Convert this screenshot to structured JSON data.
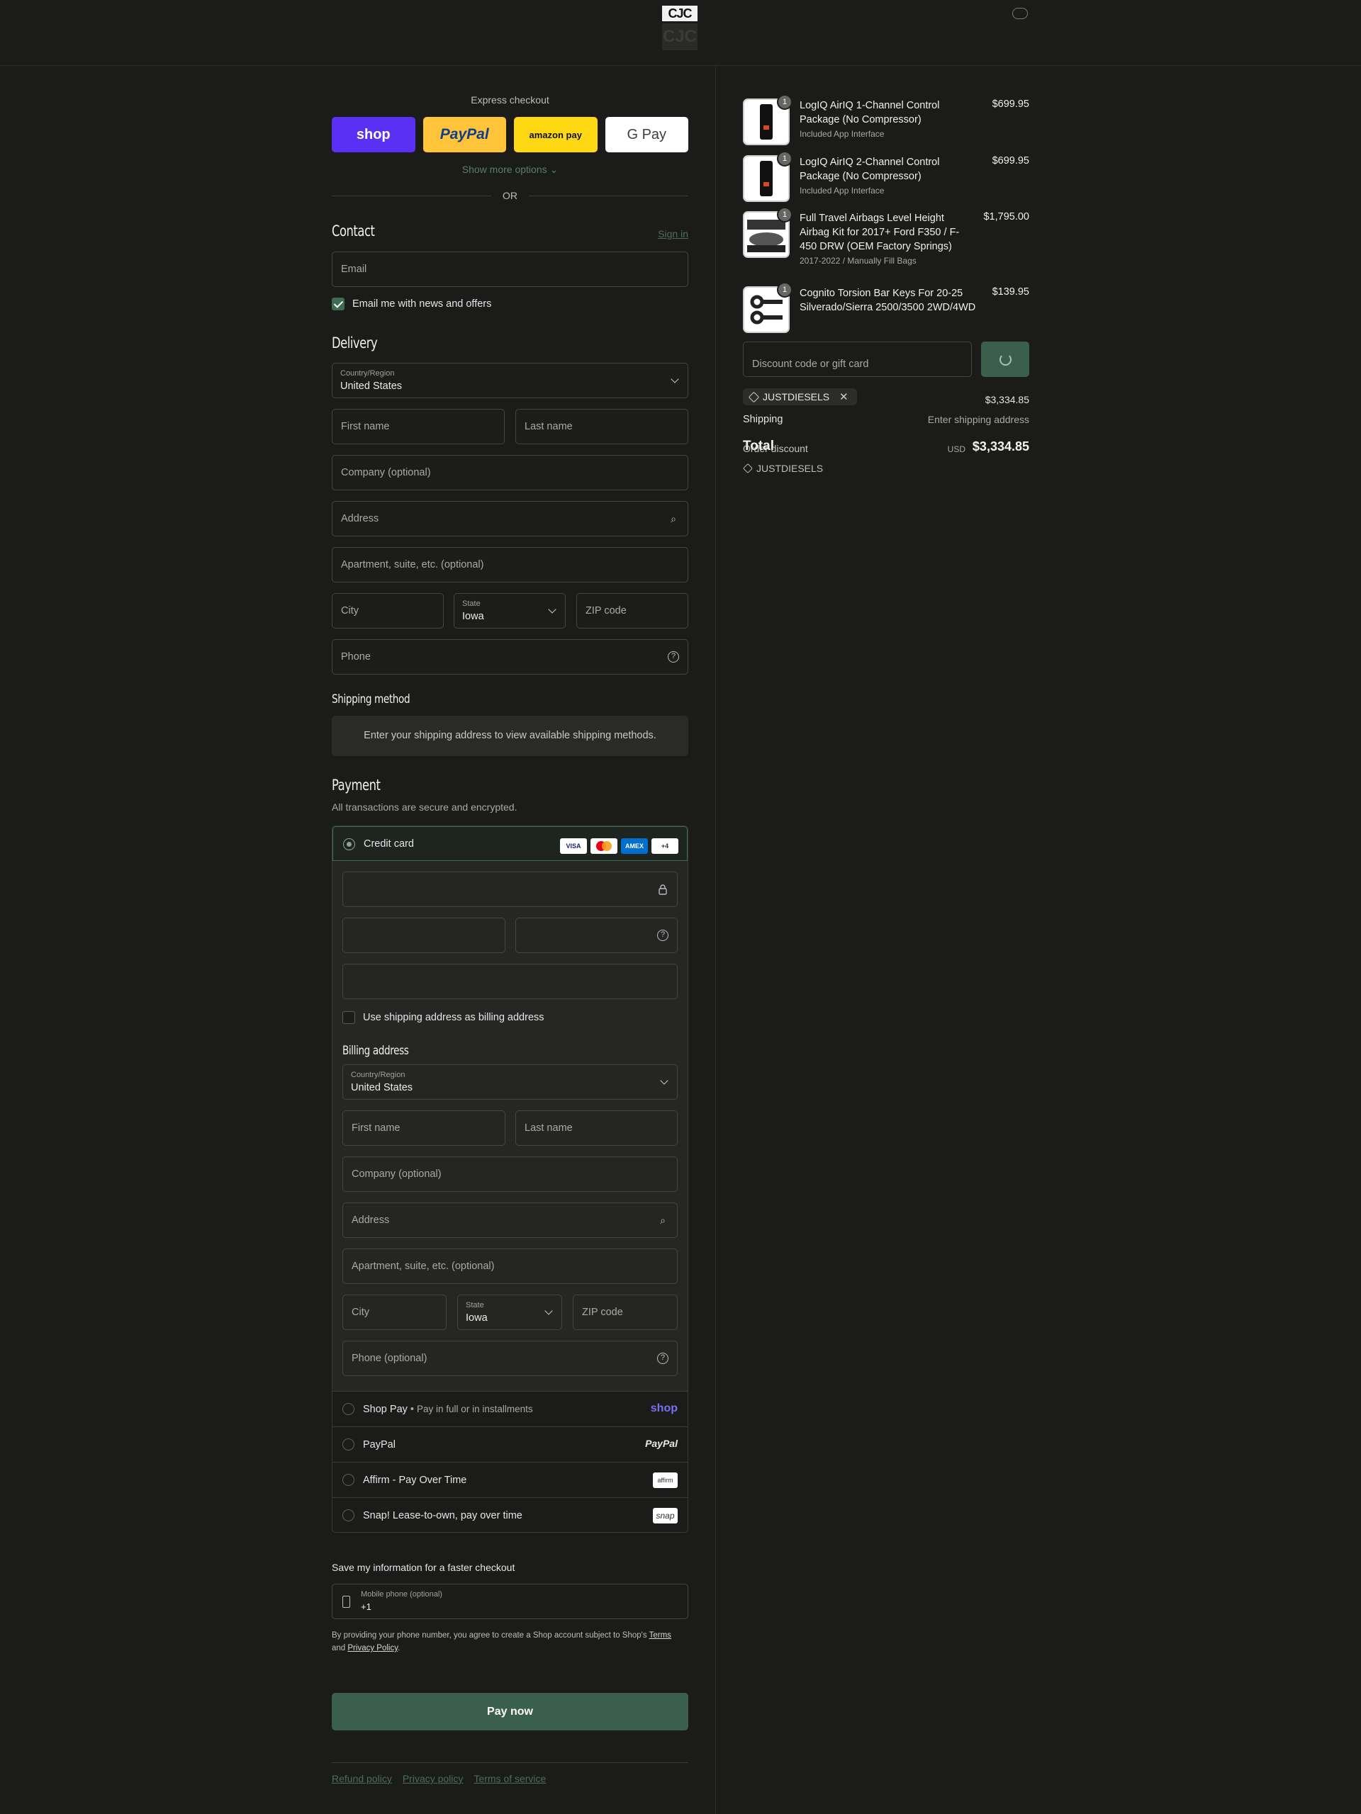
{
  "header": {
    "logo_text": "CJC",
    "logo_shadow": "CJC"
  },
  "express": {
    "title": "Express checkout",
    "buttons": [
      "shop",
      "PayPal",
      "amazon pay",
      "G Pay"
    ],
    "show_more": "Show more options ⌄",
    "or": "OR"
  },
  "contact": {
    "heading": "Contact",
    "sign_in": "Sign in",
    "email_placeholder": "Email",
    "news_label": "Email me with news and offers"
  },
  "delivery": {
    "heading": "Delivery",
    "country_label": "Country/Region",
    "country_value": "United States",
    "first_name": "First name",
    "last_name": "Last name",
    "company": "Company (optional)",
    "address": "Address",
    "apartment": "Apartment, suite, etc. (optional)",
    "city": "City",
    "state_label": "State",
    "state_value": "Iowa",
    "zip": "ZIP code",
    "phone": "Phone"
  },
  "shipping_method": {
    "heading": "Shipping method",
    "notice": "Enter your shipping address to view available shipping methods."
  },
  "payment": {
    "heading": "Payment",
    "subtitle": "All transactions are secure and encrypted.",
    "credit_card_label": "Credit card",
    "card_brands": [
      "VISA",
      "MC",
      "AMEX",
      "+4"
    ],
    "use_shipping_label": "Use shipping address as billing address",
    "billing": {
      "heading": "Billing address",
      "country_label": "Country/Region",
      "country_value": "United States",
      "first_name": "First name",
      "last_name": "Last name",
      "company": "Company (optional)",
      "address": "Address",
      "apartment": "Apartment, suite, etc. (optional)",
      "city": "City",
      "state_label": "State",
      "state_value": "Iowa",
      "zip": "ZIP code",
      "phone": "Phone (optional)"
    },
    "methods": [
      {
        "label": "Shop Pay",
        "note": "Pay in full or in installments",
        "logo": "shop"
      },
      {
        "label": "PayPal",
        "logo": "PayPal"
      },
      {
        "label": "Affirm - Pay Over Time",
        "logo": "affirm"
      },
      {
        "label": "Snap! Lease-to-own, pay over time",
        "logo": "snap"
      }
    ]
  },
  "save_info": {
    "heading": "Save my information for a faster checkout",
    "mobile_label": "Mobile phone (optional)",
    "mobile_value": "+1",
    "consent_prefix": "By providing your phone number, you agree to create a Shop account subject to Shop's",
    "terms": "Terms",
    "and": "and",
    "privacy": "Privacy Policy",
    "period": "."
  },
  "pay_now": "Pay now",
  "footer_links": [
    "Refund policy",
    "Privacy policy",
    "Terms of service"
  ],
  "summary": {
    "items": [
      {
        "qty": "1",
        "title": "LogIQ AirIQ 1-Channel Control Package (No Compressor)",
        "sub": "Included App Interface",
        "price": "$699.95"
      },
      {
        "qty": "1",
        "title": "LogIQ AirIQ 2-Channel Control Package (No Compressor)",
        "sub": "Included App Interface",
        "price": "$699.95"
      },
      {
        "qty": "1",
        "title": "Full Travel Airbags Level Height Airbag Kit for 2017+ Ford F350 / F-450 DRW (OEM Factory Springs)",
        "sub": "2017-2022 / Manually Fill Bags",
        "price": "$1,795.00"
      },
      {
        "qty": "1",
        "title": "Cognito Torsion Bar Keys For 20-25 Silverado/Sierra 2500/3500 2WD/4WD",
        "sub": "",
        "price": "$139.95"
      }
    ],
    "discount_placeholder": "Discount code or gift card",
    "applied_code": "JUSTDIESELS",
    "subtotal_value": "$3,334.85",
    "shipping_label": "Shipping",
    "shipping_value": "Enter shipping address",
    "total_label": "Total",
    "order_discount_label": "Order discount",
    "order_discount_code": "JUSTDIESELS",
    "currency": "USD",
    "total_value": "$3,334.85"
  }
}
